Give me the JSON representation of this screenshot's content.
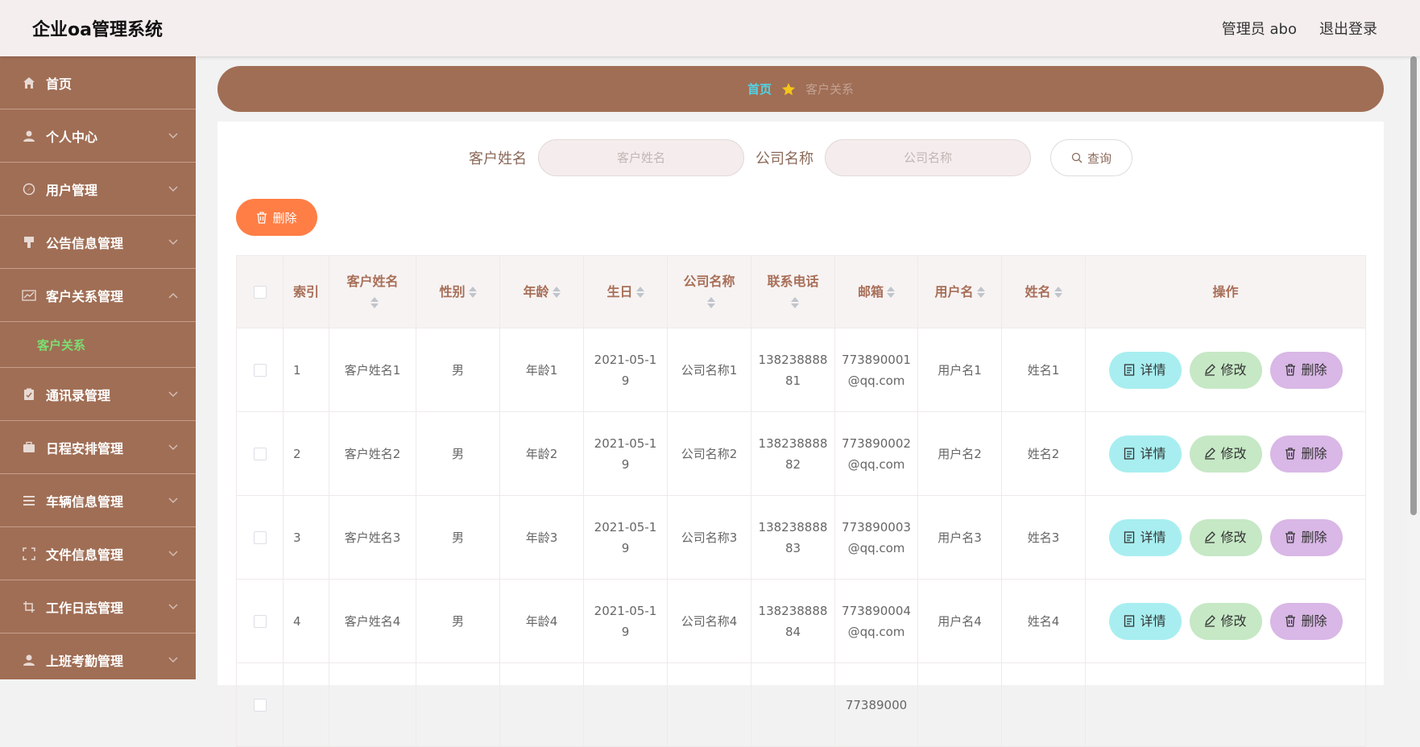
{
  "header": {
    "title": "企业oa管理系统",
    "user": "管理员 abo",
    "logout": "退出登录"
  },
  "sidebar": {
    "items": [
      {
        "label": "首页",
        "icon": "home-icon"
      },
      {
        "label": "个人中心",
        "icon": "user-icon"
      },
      {
        "label": "用户管理",
        "icon": "compass-icon"
      },
      {
        "label": "公告信息管理",
        "icon": "brush-icon"
      },
      {
        "label": "客户关系管理",
        "icon": "chart-icon"
      },
      {
        "label": "通讯录管理",
        "icon": "clipboard-icon"
      },
      {
        "label": "日程安排管理",
        "icon": "briefcase-icon"
      },
      {
        "label": "车辆信息管理",
        "icon": "list-icon"
      },
      {
        "label": "文件信息管理",
        "icon": "fullscreen-icon"
      },
      {
        "label": "工作日志管理",
        "icon": "crop-icon"
      },
      {
        "label": "上班考勤管理",
        "icon": "user-icon"
      }
    ],
    "active_submenu": "客户关系"
  },
  "breadcrumb": {
    "home": "首页",
    "current": "客户关系"
  },
  "search": {
    "name_label": "客户姓名",
    "name_placeholder": "客户姓名",
    "company_label": "公司名称",
    "company_placeholder": "公司名称",
    "query_button": "查询"
  },
  "delete_button": "删除",
  "table": {
    "columns": [
      "索引",
      "客户姓名",
      "性别",
      "年龄",
      "生日",
      "公司名称",
      "联系电话",
      "邮箱",
      "用户名",
      "姓名",
      "操作"
    ],
    "rows": [
      {
        "index": "1",
        "name": "客户姓名1",
        "gender": "男",
        "age": "年龄1",
        "birthday": "2021-05-19",
        "company": "公司名称1",
        "phone": "13823888881",
        "email": "773890001@qq.com",
        "username": "用户名1",
        "realname": "姓名1"
      },
      {
        "index": "2",
        "name": "客户姓名2",
        "gender": "男",
        "age": "年龄2",
        "birthday": "2021-05-19",
        "company": "公司名称2",
        "phone": "13823888882",
        "email": "773890002@qq.com",
        "username": "用户名2",
        "realname": "姓名2"
      },
      {
        "index": "3",
        "name": "客户姓名3",
        "gender": "男",
        "age": "年龄3",
        "birthday": "2021-05-19",
        "company": "公司名称3",
        "phone": "13823888883",
        "email": "773890003@qq.com",
        "username": "用户名3",
        "realname": "姓名3"
      },
      {
        "index": "4",
        "name": "客户姓名4",
        "gender": "男",
        "age": "年龄4",
        "birthday": "2021-05-19",
        "company": "公司名称4",
        "phone": "13823888884",
        "email": "773890004@qq.com",
        "username": "用户名4",
        "realname": "姓名4"
      },
      {
        "index": "",
        "name": "",
        "gender": "",
        "age": "",
        "birthday": "",
        "company": "",
        "phone": "",
        "email": "77389000",
        "username": "",
        "realname": ""
      }
    ],
    "actions": {
      "detail": "详情",
      "edit": "修改",
      "delete": "删除"
    }
  },
  "colors": {
    "sidebar": "#a06e55",
    "accent_orange": "#ff7e45",
    "detail": "#a8eef0",
    "edit": "#c6e8c5",
    "delete": "#d9b7e6",
    "active_submenu": "#7bde72"
  }
}
